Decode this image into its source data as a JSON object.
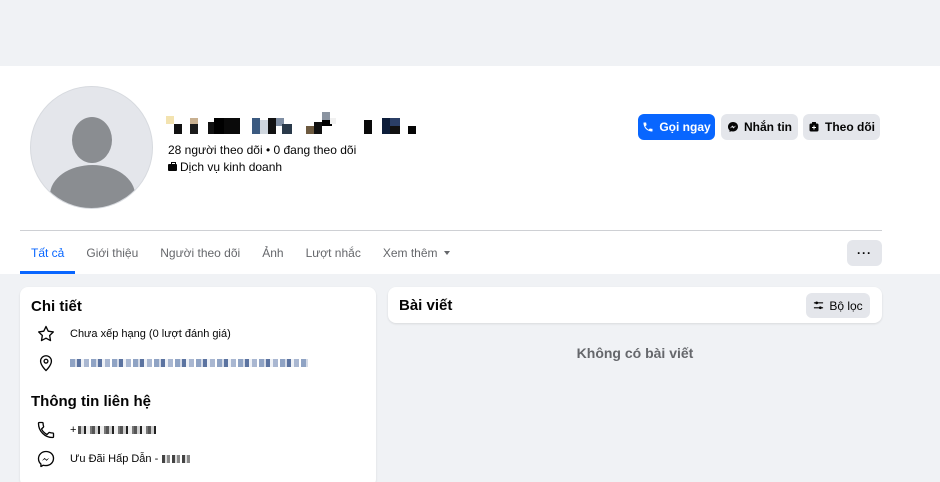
{
  "profile": {
    "followers_text": "28 người theo dõi • 0 đang theo dõi",
    "category": "Dịch vụ kinh doanh"
  },
  "actions": {
    "call": "Gọi ngay",
    "message": "Nhắn tin",
    "follow": "Theo dõi"
  },
  "tabs": [
    {
      "label": "Tất cả"
    },
    {
      "label": "Giới thiệu"
    },
    {
      "label": "Người theo dõi"
    },
    {
      "label": "Ảnh"
    },
    {
      "label": "Lượt nhắc"
    },
    {
      "label": "Xem thêm"
    }
  ],
  "more_button": "···",
  "details": {
    "title": "Chi tiết",
    "rating": "Chưa xếp hạng (0 lượt đánh giá)",
    "contact_title": "Thông tin liên hệ",
    "phone_prefix": "+",
    "messenger_text": "Ưu Đãi Hấp Dẫn -"
  },
  "posts": {
    "title": "Bài viết",
    "filter": "Bộ lọc",
    "empty": "Không có bài viết"
  },
  "colors": {
    "accent": "#0866ff",
    "background": "#f0f2f5",
    "secondary_text": "#65676b"
  }
}
